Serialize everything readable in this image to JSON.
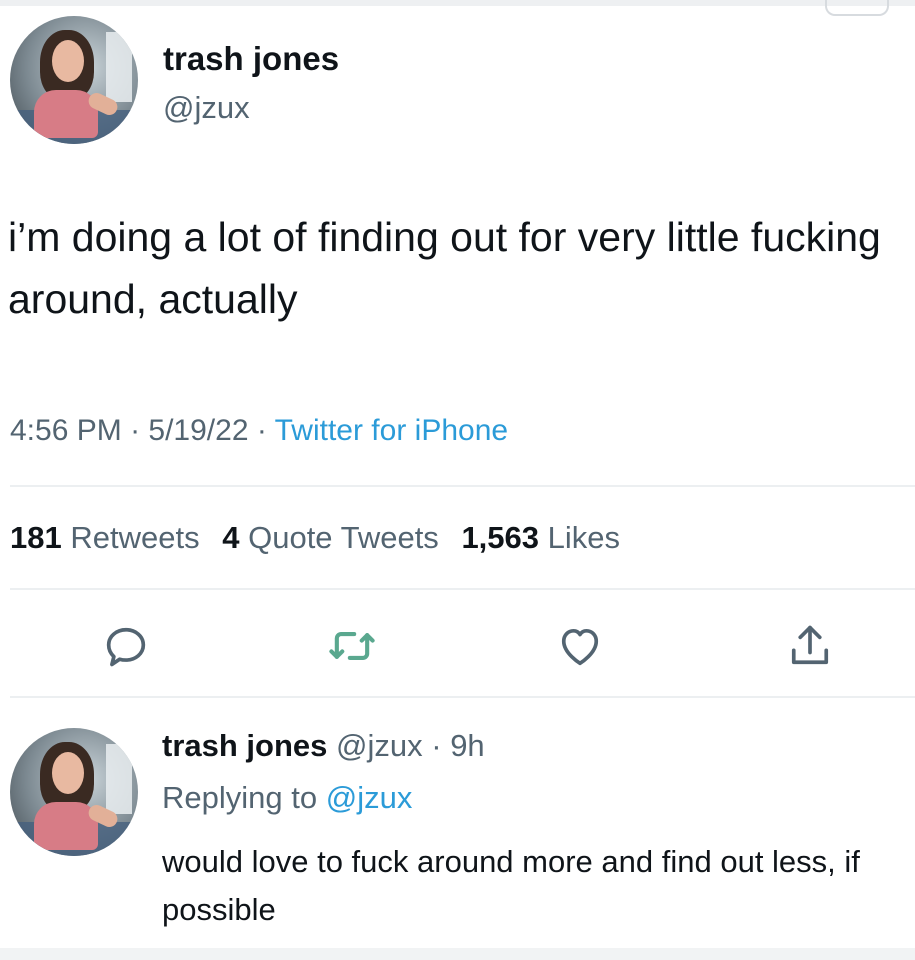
{
  "tweet": {
    "author": {
      "name": "trash jones",
      "handle": "@jzux"
    },
    "text": "i’m doing a lot of finding out for very little fucking around, actually",
    "meta": {
      "time": "4:56 PM",
      "date": "5/19/22",
      "source": "Twitter for iPhone",
      "separator": " · "
    },
    "stats": {
      "retweets_count": "181",
      "retweets_label": "Retweets",
      "quotes_count": "4",
      "quotes_label": "Quote Tweets",
      "likes_count": "1,563",
      "likes_label": "Likes"
    },
    "actions": {
      "reply_icon": "reply-icon",
      "retweet_icon": "retweet-icon",
      "like_icon": "heart-icon",
      "share_icon": "share-icon"
    }
  },
  "reply": {
    "author": {
      "name": "trash jones",
      "handle": "@jzux",
      "age": "9h",
      "separator": " · "
    },
    "replying_prefix": "Replying to ",
    "replying_to": "@jzux",
    "text": "would love to fuck around more and find out less, if possible"
  },
  "colors": {
    "text": "#0f1419",
    "secondary": "#536471",
    "link": "#2b9bd8",
    "retweet_green": "#5aa88f"
  }
}
